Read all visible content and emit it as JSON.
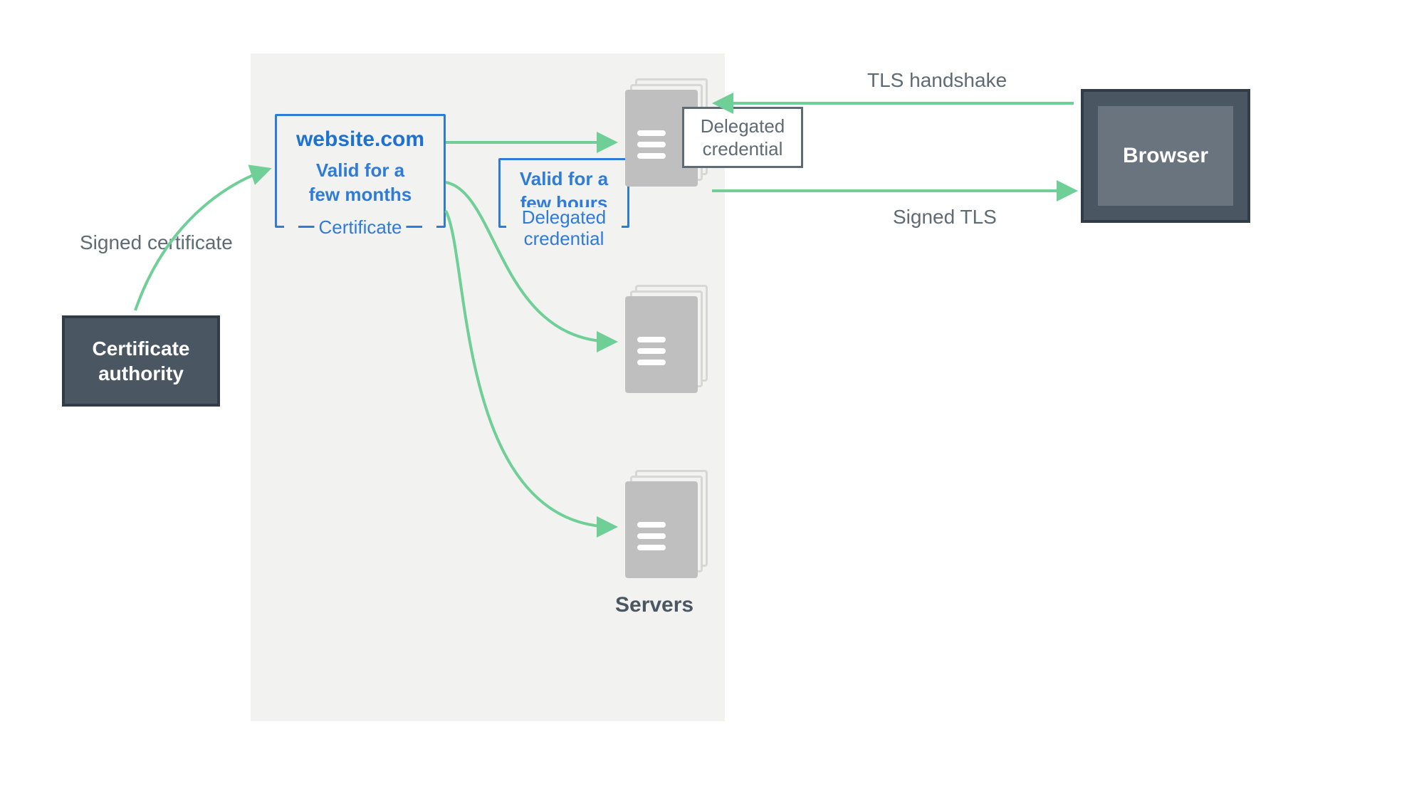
{
  "boxes": {
    "ca": "Certificate\nauthority",
    "browser": "Browser"
  },
  "certificate": {
    "domain": "website.com",
    "validity": "Valid for a\nfew months",
    "tag": "Certificate"
  },
  "delegated_credential": {
    "validity": "Valid for a\nfew hours",
    "tag": "Delegated\ncredential"
  },
  "labels": {
    "signed_certificate": "Signed certificate",
    "tls_handshake": "TLS handshake",
    "signed_tls": "Signed TLS",
    "delegated_credential_box": "Delegated\ncredential",
    "servers": "Servers"
  },
  "colors": {
    "arrow": "#6fcf97",
    "blue": "#2f7bd9",
    "dark": "#4a5763",
    "text": "#5f6b74",
    "panel": "#f2f2f0"
  }
}
